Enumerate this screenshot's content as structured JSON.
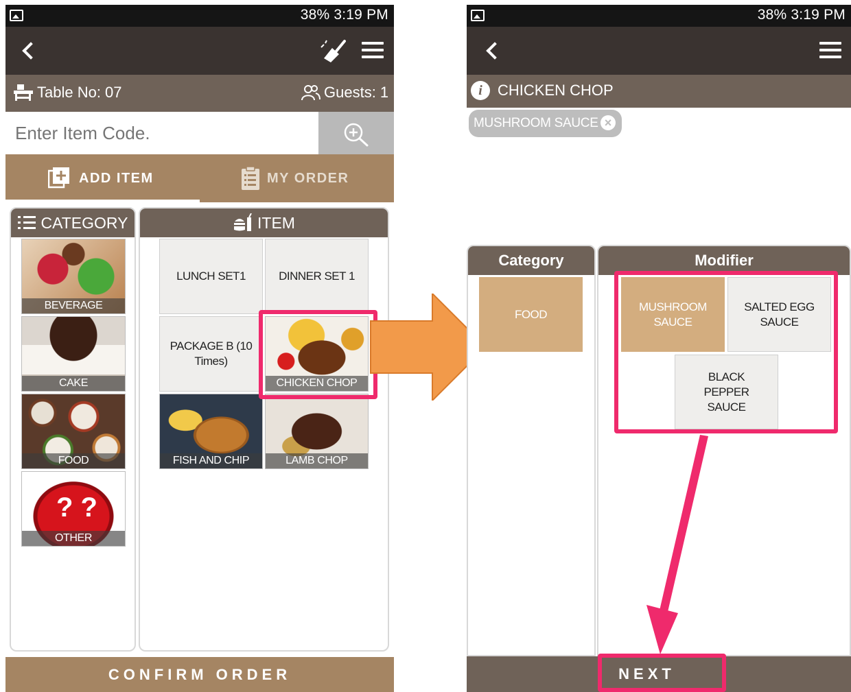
{
  "status_bar": {
    "text": "38% 3:19 PM"
  },
  "left_screen": {
    "table_label": "Table No: 07",
    "guests_label": "Guests: 1",
    "search": {
      "placeholder": "Enter Item Code."
    },
    "tabs": [
      {
        "label": "ADD ITEM",
        "active": true
      },
      {
        "label": "MY ORDER",
        "active": false
      }
    ],
    "category_header": "CATEGORY",
    "item_header": "ITEM",
    "categories": [
      {
        "label": "BEVERAGE"
      },
      {
        "label": "CAKE"
      },
      {
        "label": "FOOD"
      },
      {
        "label": "OTHER"
      }
    ],
    "items": [
      {
        "label": "LUNCH SET1"
      },
      {
        "label": "DINNER SET 1"
      },
      {
        "label": "PACKAGE B (10 Times)"
      },
      {
        "label": "CHICKEN CHOP"
      },
      {
        "label": "FISH AND CHIP"
      },
      {
        "label": "LAMB CHOP"
      }
    ],
    "confirm_label": "CONFIRM ORDER"
  },
  "right_screen": {
    "title": "CHICKEN CHOP",
    "chip": "MUSHROOM SAUCE",
    "category_header": "Category",
    "modifier_header": "Modifier",
    "category_item": "FOOD",
    "modifiers": [
      {
        "label": "MUSHROOM SAUCE",
        "selected": true
      },
      {
        "label": "SALTED EGG SAUCE",
        "selected": false
      },
      {
        "label": "BLACK PEPPER SAUCE",
        "selected": false
      }
    ],
    "next_label": "NEXT"
  },
  "colors": {
    "dark_bar": "#3a3330",
    "brown_bar": "#6f6258",
    "tan": "#a58563",
    "selected_tile": "#d3ad7f",
    "highlight": "#ef2a6c",
    "arrow": "#f29a4a"
  }
}
